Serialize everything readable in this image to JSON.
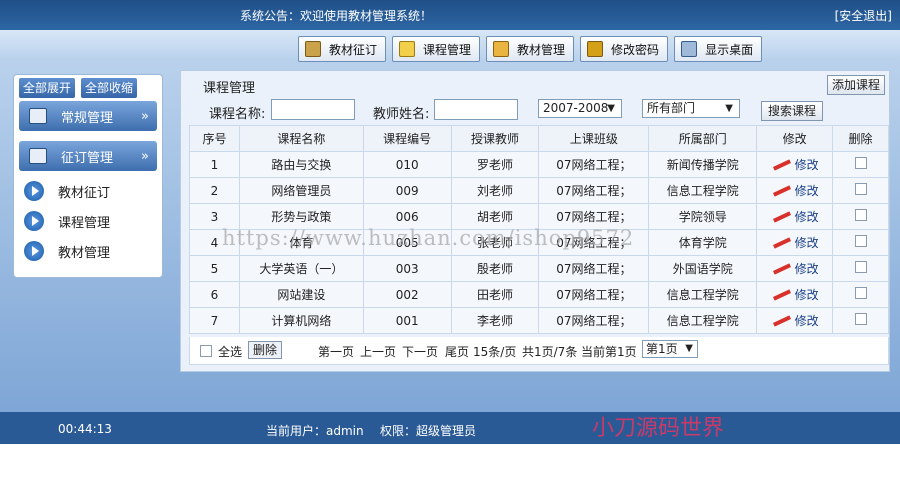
{
  "topbar": {
    "notice": "系统公告：欢迎使用教材管理系统！",
    "logout": "[安全退出]"
  },
  "toolbar": {
    "buttons": [
      {
        "label": "教材征订",
        "icon": "book-order-icon"
      },
      {
        "label": "课程管理",
        "icon": "course-icon"
      },
      {
        "label": "教材管理",
        "icon": "textbook-icon"
      },
      {
        "label": "修改密码",
        "icon": "key-icon"
      },
      {
        "label": "显示桌面",
        "icon": "desktop-icon"
      }
    ]
  },
  "sidebar": {
    "expand_all": "全部展开",
    "collapse_all": "全部收缩",
    "sections": [
      {
        "label": "常规管理",
        "icon": "settings-icon"
      },
      {
        "label": "征订管理",
        "icon": "order-icon"
      }
    ],
    "items": [
      "教材征订",
      "课程管理",
      "教材管理"
    ]
  },
  "panel": {
    "title": "课程管理",
    "add_button": "添加课程",
    "search": {
      "course_label": "课程名称:",
      "course_value": "",
      "teacher_label": "教师姓名:",
      "teacher_value": "",
      "year_value": "2007-2008",
      "dept_value": "所有部门",
      "search_button": "搜索课程"
    },
    "table": {
      "headers": [
        "序号",
        "课程名称",
        "课程编号",
        "授课教师",
        "上课班级",
        "所属部门",
        "修改",
        "删除"
      ],
      "edit_label": "修改",
      "rows": [
        {
          "no": "1",
          "name": "路由与交换",
          "code": "010",
          "teacher": "罗老师",
          "cls": "07网络工程；",
          "dept": "新闻传播学院"
        },
        {
          "no": "2",
          "name": "网络管理员",
          "code": "009",
          "teacher": "刘老师",
          "cls": "07网络工程；",
          "dept": "信息工程学院"
        },
        {
          "no": "3",
          "name": "形势与政策",
          "code": "006",
          "teacher": "胡老师",
          "cls": "07网络工程；",
          "dept": "学院领导"
        },
        {
          "no": "4",
          "name": "体育",
          "code": "005",
          "teacher": "张老师",
          "cls": "07网络工程；",
          "dept": "体育学院"
        },
        {
          "no": "5",
          "name": "大学英语（一）",
          "code": "003",
          "teacher": "殷老师",
          "cls": "07网络工程；",
          "dept": "外国语学院"
        },
        {
          "no": "6",
          "name": "网站建设",
          "code": "002",
          "teacher": "田老师",
          "cls": "07网络工程；",
          "dept": "信息工程学院"
        },
        {
          "no": "7",
          "name": "计算机网络",
          "code": "001",
          "teacher": "李老师",
          "cls": "07网络工程；",
          "dept": "信息工程学院"
        }
      ]
    },
    "pager": {
      "select_all": "全选",
      "delete": "删除",
      "first": "第一页",
      "prev": "上一页",
      "next": "下一页",
      "last": "尾页",
      "per_page": "15条/页",
      "totals": "共1页/7条",
      "current": "当前第1页",
      "page_select": "第1页"
    }
  },
  "footer": {
    "time": "00:44:13",
    "user": "当前用户：admin",
    "role": "权限：超级管理员"
  },
  "watermarks": {
    "url": "https://www.huzhan.com/ishop9572",
    "brand": "小刀源码世界"
  }
}
